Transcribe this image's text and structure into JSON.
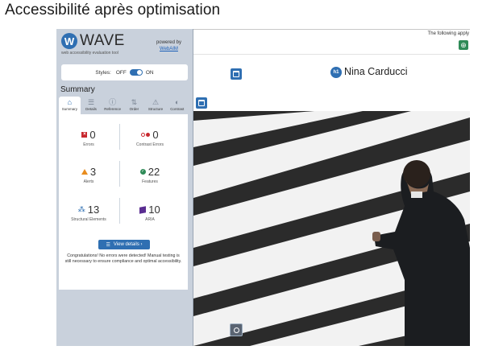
{
  "caption": "Accessibilité après optimisation",
  "wave": {
    "logo_mark": "W",
    "name": "WAVE",
    "tagline": "web accessibility evaluation tool",
    "powered_by": "powered by",
    "powered_link": "WebAIM",
    "styles_label": "Styles:",
    "off_label": "OFF",
    "on_label": "ON",
    "summary_title": "Summary",
    "tabs": [
      {
        "label": "Summary",
        "icon": "home-icon",
        "glyph": "⌂"
      },
      {
        "label": "Details",
        "icon": "list-icon",
        "glyph": "☰"
      },
      {
        "label": "Reference",
        "icon": "info-icon",
        "glyph": "ⓘ"
      },
      {
        "label": "Order",
        "icon": "order-icon",
        "glyph": "⇅"
      },
      {
        "label": "Structure",
        "icon": "structure-icon",
        "glyph": "⚠"
      },
      {
        "label": "Contrast",
        "icon": "contrast-icon",
        "glyph": "◐"
      }
    ],
    "stats": {
      "errors": {
        "value": "0",
        "label": "Errors"
      },
      "contrast_errors": {
        "value": "0",
        "label": "Contrast Errors"
      },
      "alerts": {
        "value": "3",
        "label": "Alerts"
      },
      "features": {
        "value": "22",
        "label": "Features"
      },
      "structural": {
        "value": "13",
        "label": "Structural Elements"
      },
      "aria": {
        "value": "10",
        "label": "ARIA"
      }
    },
    "view_details": "View details ›",
    "congrats": "Congratulations! No errors were detected! Manual testing is still necessary to ensure compliance and optimal accessibility."
  },
  "page": {
    "following_text": "The following apply",
    "heading_badge": "h1",
    "person_name": "Nina Carducci"
  },
  "colors": {
    "wave_blue": "#2f6fb2",
    "error_red": "#c8282e",
    "alert_orange": "#e88c1e",
    "feature_green": "#2e8b57",
    "aria_purple": "#5a2d91",
    "panel_bg": "#c9d1dc"
  }
}
